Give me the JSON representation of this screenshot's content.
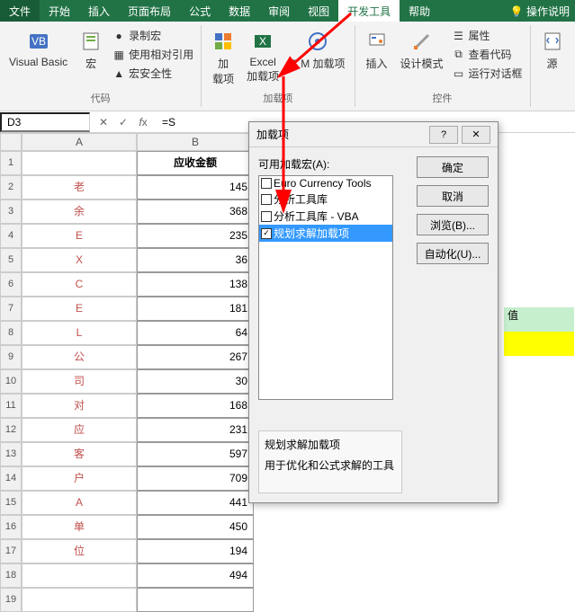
{
  "menu": {
    "file": "文件",
    "home": "开始",
    "insert": "插入",
    "pagelayout": "页面布局",
    "formulas": "公式",
    "data": "数据",
    "review": "审阅",
    "view": "视图",
    "developer": "开发工具",
    "help": "帮助",
    "tellme": "操作说明"
  },
  "ribbon": {
    "visualbasic": "Visual Basic",
    "macro": "宏",
    "record": "录制宏",
    "relref": "使用相对引用",
    "macrosafe": "宏安全性",
    "addins": "加\n载项",
    "exceladdins": "Excel\n加载项",
    "comaddins": "C M 加载项",
    "insert": "插入",
    "designmode": "设计模式",
    "properties": "属性",
    "viewcode": "查看代码",
    "rundialog": "运行对话框",
    "source": "源",
    "g_code": "代码",
    "g_addins": "加载项",
    "g_controls": "控件"
  },
  "namebox": "D3",
  "formula": "=S",
  "cols": {
    "a": "A",
    "b": "B"
  },
  "headerB": "应收金额",
  "colA": [
    "老",
    "余",
    "E",
    "X",
    "C",
    "E",
    "L",
    "公",
    "司",
    "对",
    "应",
    "客",
    "户",
    "A",
    "单",
    "位"
  ],
  "colB": [
    145,
    368,
    235,
    36,
    138,
    181,
    64,
    267,
    30,
    168,
    231,
    597,
    709,
    441,
    450,
    194,
    494
  ],
  "dialog": {
    "title": "加载项",
    "label": "可用加载宏(A):",
    "items": [
      "Euro Currency Tools",
      "分析工具库",
      "分析工具库 - VBA",
      "规划求解加载项"
    ],
    "checked": [
      false,
      false,
      false,
      true
    ],
    "selected": 3,
    "ok": "确定",
    "cancel": "取消",
    "browse": "浏览(B)...",
    "auto": "自动化(U)...",
    "desc_title": "规划求解加载项",
    "desc_text": "用于优化和公式求解的工具"
  },
  "extra": {
    "value_label": "值"
  }
}
